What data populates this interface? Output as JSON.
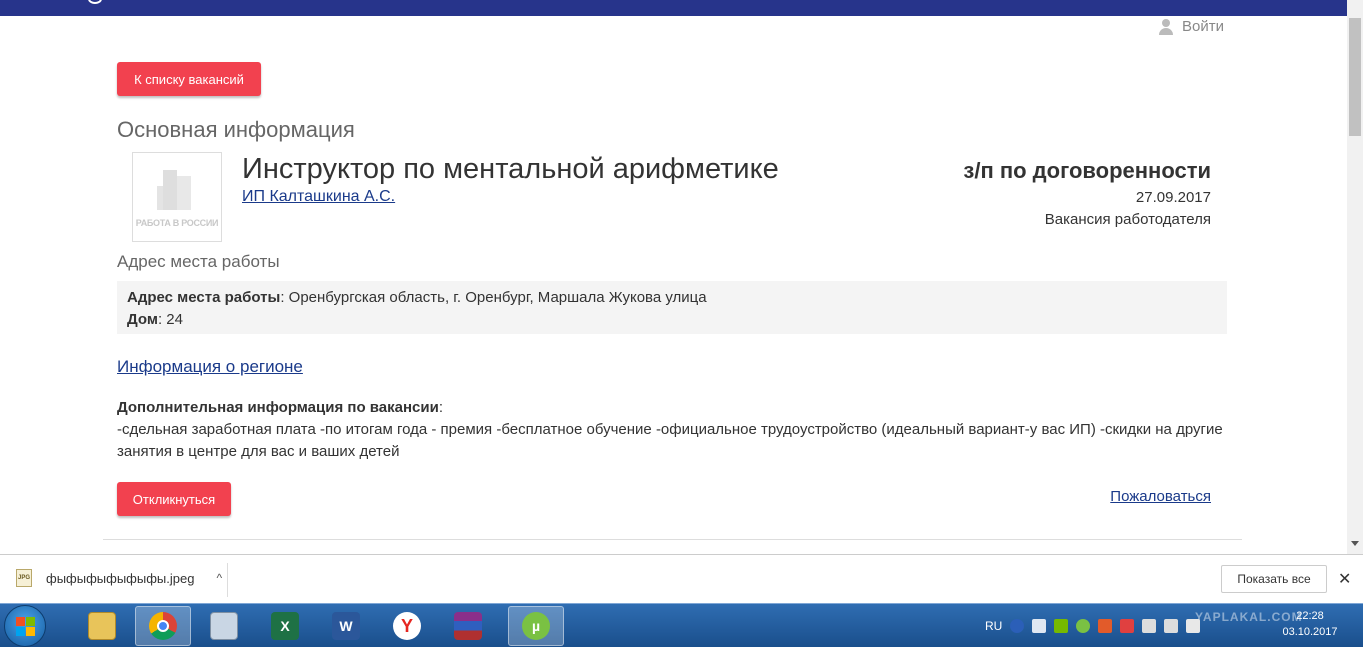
{
  "header": {
    "login_label": "Войти"
  },
  "buttons": {
    "back_label": "К списку вакансий",
    "apply_label": "Откликнуться"
  },
  "main": {
    "section_title": "Основная информация",
    "logo_caption": "РАБОТА В РОССИИ",
    "job_title": "Инструктор по ментальной арифметике",
    "employer": "ИП Калташкина А.С.",
    "salary": "з/п по договоренности",
    "date": "27.09.2017",
    "vacancy_type": "Вакансия работодателя"
  },
  "address": {
    "title": "Адрес места работы",
    "address_label": "Адрес места работы",
    "address_value": ": Оренбургская область, г. Оренбург, Маршала Жукова улица",
    "house_label": "Дом",
    "house_value": ": 24"
  },
  "region_link": "Информация о регионе",
  "extra": {
    "label": "Дополнительная информация по вакансии",
    "colon": ":",
    "text": "-сдельная заработная плата -по итогам года - премия -бесплатное обучение -официальное трудоустройство (идеальный вариант-у вас ИП) -скидки на другие занятия в центре для вас и ваших детей"
  },
  "complain_link": "Пожаловаться",
  "downloads": {
    "file_name": "фыфыфыфыфыфы.jpeg",
    "file_type_label": "JPG",
    "show_all_label": "Показать все",
    "close_glyph": "✕",
    "chevron_glyph": "^"
  },
  "taskbar": {
    "apps": [
      "explorer-icon",
      "chrome-icon",
      "calculator-icon",
      "excel-icon",
      "word-icon",
      "yandex-icon",
      "winrar-icon",
      "utorrent-icon"
    ],
    "active_app": "utorrent-icon",
    "language": "RU",
    "time": "22:28",
    "date": "03.10.2017",
    "watermark": "YAPLAKAL.COM"
  },
  "colors": {
    "nav": "#27348b",
    "accent_red": "#f2414f",
    "link": "#1a3a8a"
  }
}
